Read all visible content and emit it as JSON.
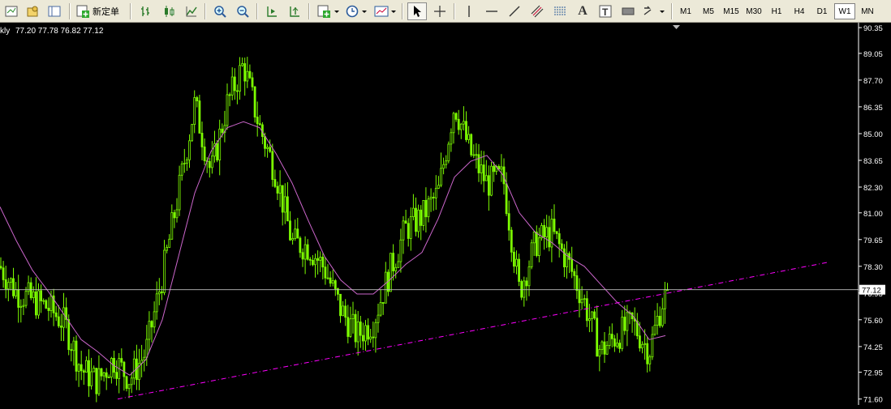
{
  "toolbar": {
    "new_order_label": "新定单",
    "timeframes": [
      "M1",
      "M5",
      "M15",
      "M30",
      "H1",
      "H4",
      "D1",
      "W1",
      "MN"
    ],
    "active_timeframe": "W1"
  },
  "chart": {
    "symbol_label": "kly",
    "ohlc_text": "77.20 77.78 76.82 77.12",
    "price_axis_labels": [
      "90.35",
      "89.05",
      "87.70",
      "86.35",
      "85.00",
      "83.65",
      "82.30",
      "81.00",
      "79.65",
      "78.30",
      "76.95",
      "75.60",
      "74.25",
      "72.95",
      "71.60"
    ],
    "current_price": "77.12",
    "colors": {
      "background": "#000000",
      "candle": "#7cfc00",
      "ma": "#cc66cc",
      "trendline": "#ff00ff",
      "price_line": "#c0c0c0",
      "axis_text": "#ffffff"
    }
  },
  "chart_data": {
    "type": "candlestick",
    "x": [
      0,
      20,
      40,
      60,
      80,
      100,
      120,
      140,
      160,
      180,
      200,
      220,
      240,
      260,
      280,
      300,
      320,
      340,
      360,
      380,
      400,
      420,
      440,
      460,
      480,
      500,
      520,
      540,
      560,
      580,
      600,
      620,
      640,
      660,
      680,
      700,
      720,
      740,
      760,
      780,
      800,
      820
    ],
    "close": [
      78.3,
      77.0,
      76.6,
      76.2,
      75.4,
      73.1,
      72.5,
      73.6,
      72.6,
      74.0,
      77.8,
      82.0,
      86.5,
      83.0,
      86.5,
      88.5,
      85.3,
      83.0,
      79.5,
      79.3,
      78.2,
      76.1,
      74.8,
      75.5,
      78.0,
      80.2,
      80.8,
      82.0,
      86.5,
      84.0,
      82.5,
      82.8,
      77.0,
      79.5,
      80.0,
      78.5,
      76.5,
      74.0,
      74.8,
      75.4,
      74.0,
      77.12
    ],
    "ma": [
      81.3,
      79.6,
      78.1,
      77.0,
      75.8,
      74.6,
      74.0,
      73.3,
      72.8,
      73.6,
      75.6,
      78.8,
      82.0,
      84.1,
      85.3,
      85.6,
      85.3,
      84.0,
      82.5,
      80.6,
      78.8,
      77.6,
      76.9,
      76.9,
      77.6,
      78.4,
      79.0,
      80.7,
      82.8,
      83.6,
      83.9,
      82.9,
      81.0,
      80.0,
      79.5,
      78.8,
      78.3,
      77.4,
      76.5,
      75.8,
      74.6,
      74.8
    ],
    "trendline": {
      "from": [
        145,
        71.6
      ],
      "to": [
        1020,
        78.5
      ]
    },
    "current_price": 77.12,
    "ylim": [
      71.3,
      90.6
    ]
  }
}
